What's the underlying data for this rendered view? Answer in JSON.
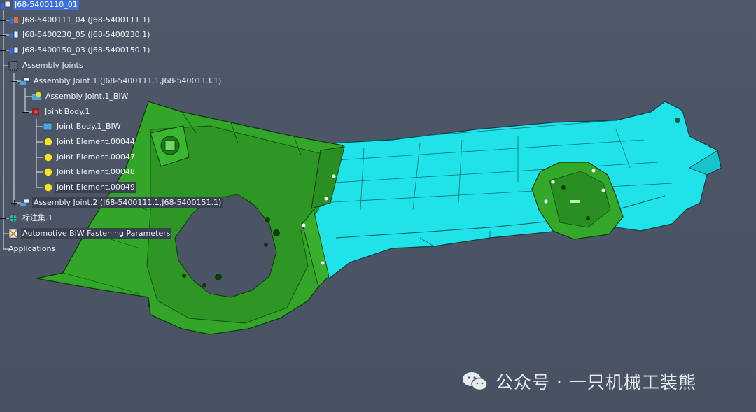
{
  "tree": {
    "root": {
      "label": "J68-5400110_01",
      "icon": "product-icon"
    },
    "parts": [
      {
        "label": "J68-5400111_04 (J68-5400111.1)",
        "icon": "part-icon"
      },
      {
        "label": "J68-5400230_05 (J68-5400230.1)",
        "icon": "part-icon"
      },
      {
        "label": "J68-5400150_03 (J68-5400150.1)",
        "icon": "part-icon"
      }
    ],
    "assembly_joints": {
      "label": "Assembly Joints",
      "icon": "assembly-joints-icon"
    },
    "assembly_joint_1": {
      "label": "Assembly Joint.1 (J68-5400111.1,J68-5400113.1)",
      "icon": "assembly-joint-icon"
    },
    "assembly_joint_1_biw": {
      "label": "Assembly Joint.1_BIW",
      "icon": "biw-icon"
    },
    "joint_body_1": {
      "label": "Joint Body.1",
      "icon": "joint-body-icon"
    },
    "joint_body_1_biw": {
      "label": "Joint Body.1_BIW",
      "icon": "biw-icon"
    },
    "joint_elements": [
      {
        "label": "Joint Element.00044",
        "icon": "joint-element-icon"
      },
      {
        "label": "Joint Element.00047",
        "icon": "joint-element-icon"
      },
      {
        "label": "Joint Element.00048",
        "icon": "joint-element-icon"
      },
      {
        "label": "Joint Element.00049",
        "icon": "joint-element-icon"
      }
    ],
    "assembly_joint_2": {
      "label": "Assembly Joint.2 (J68-5400111.1,J68-5400151.1)",
      "icon": "assembly-joint-icon"
    },
    "annotation_set": {
      "label": "标注集.1",
      "icon": "annotation-set-icon"
    },
    "fastening_params": {
      "label": "Automotive BiW Fastening Parameters",
      "icon": "fastening-params-icon"
    },
    "applications": {
      "label": "Applications"
    }
  },
  "watermark": {
    "text": "公众号 · 一只机械工装熊",
    "icon": "wechat-icon"
  },
  "colors": {
    "background": "#4b5564",
    "green_part": "#2f9e27",
    "green_dark": "#1f6f18",
    "cyan_part": "#1fe6ea",
    "cyan_dark": "#12a8b4",
    "selected": "#3f6fd8"
  }
}
